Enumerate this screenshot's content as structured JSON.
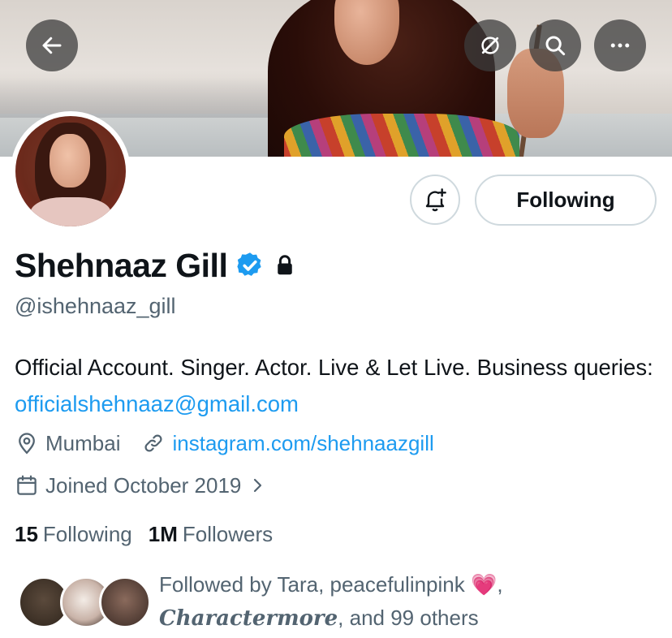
{
  "header": {
    "back_icon": "arrow-left-icon",
    "nav_icons": [
      "translate-off-icon",
      "search-icon",
      "more-icon"
    ]
  },
  "profile": {
    "name": "Shehnaaz Gill",
    "handle": "@ishehnaaz_gill",
    "verified_icon": "verified-badge-icon",
    "verified_color": "#1d9bf0",
    "protected_icon": "lock-icon",
    "follow_button_label": "Following",
    "notify_icon": "bell-plus-icon",
    "bio_text": "Official Account. Singer. Actor. Live & Let Live. Business queries: ",
    "bio_email": "officialshehnaaz@gmail.com",
    "location": "Mumbai",
    "website": "instagram.com/shehnaazgill",
    "joined": "Joined October 2019",
    "following_count": "15",
    "following_label": "Following",
    "followers_count": "1M",
    "followers_label": "Followers"
  },
  "followed_by": {
    "prefix": "Followed by Tara, peacefulinpink ",
    "emoji": "💗",
    "comma": ",",
    "styled_name": "Charactermore",
    "suffix": ", and 99 others"
  },
  "colors": {
    "link": "#1d9bf0",
    "secondary_text": "#536471",
    "primary_text": "#0f1419",
    "border": "#cfd9de"
  }
}
